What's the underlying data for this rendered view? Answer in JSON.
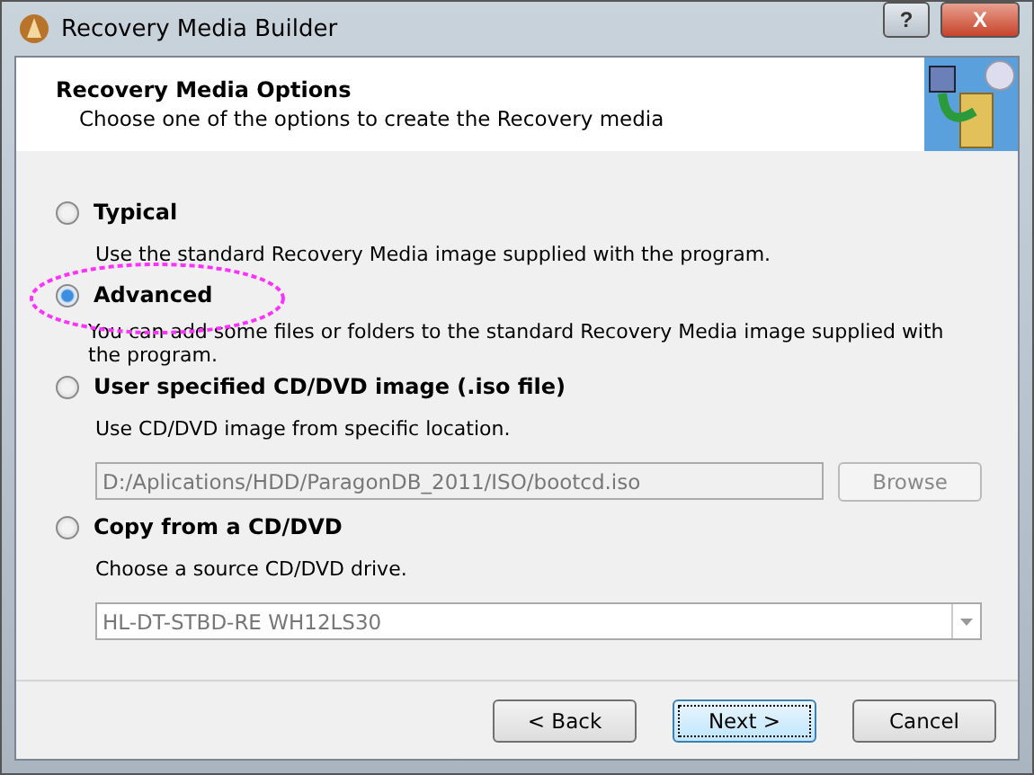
{
  "window": {
    "title": "Recovery Media Builder",
    "buttons": [
      {
        "kind": "help",
        "label": "?"
      },
      {
        "kind": "close",
        "label": "X"
      }
    ]
  },
  "header": {
    "title": "Recovery Media Options",
    "subtitle": "Choose one of the options to create the Recovery media"
  },
  "options": [
    {
      "kind": "plain",
      "label": "Typical",
      "description": "Use the standard Recovery Media image supplied with the program.",
      "selected": false,
      "circled": false
    },
    {
      "kind": "plain",
      "label": "Advanced",
      "description": "You can add some files or folders to the standard Recovery Media image supplied with the program.",
      "selected": true,
      "circled": true
    },
    {
      "kind": "file",
      "label": "User specified CD/DVD image (.iso file)",
      "description": "Use CD/DVD image from specific location.",
      "selected": false,
      "circled": false,
      "path": "D:/Aplications/HDD/ParagonDB_2011/ISO/bootcd.iso",
      "button": "Browse",
      "disabled": true
    },
    {
      "kind": "drive",
      "label": "Copy from a CD/DVD",
      "description": "Choose a source CD/DVD drive.",
      "selected": false,
      "circled": false,
      "drive": "HL-DT-STBD-RE  WH12LS30",
      "disabled": true
    }
  ],
  "footer": {
    "buttons": [
      {
        "label": "< Back",
        "focused": false
      },
      {
        "label": "Next >",
        "focused": true
      },
      {
        "label": "Cancel",
        "focused": false
      }
    ]
  }
}
